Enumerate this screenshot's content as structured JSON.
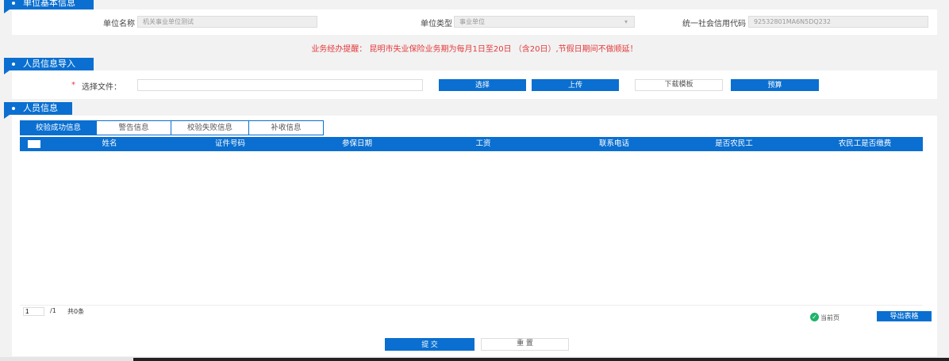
{
  "section1": {
    "title": "单位基本信息",
    "unit_name_label": "单位名称",
    "unit_name_value": "机关事业单位测试",
    "unit_type_label": "单位类型",
    "unit_type_value": "事业单位",
    "credit_code_label": "统一社会信用代码",
    "credit_code_value": "92532801MA6N5DQ232"
  },
  "notice": "业务经办提醒： 昆明市失业保险业务期为每月1日至20日 （含20日）,节假日期间不做顺延！",
  "section2": {
    "title": "人员信息导入",
    "required_mark": "*",
    "file_label": "选择文件：",
    "file_value": "",
    "select_btn": "选择",
    "upload_btn": "上传",
    "download_btn": "下载模板",
    "precalc_btn": "预算"
  },
  "section3": {
    "title": "人员信息",
    "tabs": [
      "校验成功信息",
      "警告信息",
      "校验失败信息",
      "补收信息"
    ],
    "columns": [
      "姓名",
      "证件号码",
      "参保日期",
      "工资",
      "联系电话",
      "是否农民工",
      "农民工是否缴费"
    ]
  },
  "pagination": {
    "page": "1",
    "total_pages": "/1",
    "total": "共0条",
    "current_page_label": "当前页",
    "export_btn": "导出表格"
  },
  "footer": {
    "submit": "提 交",
    "reset": "重 置"
  },
  "colors": {
    "primary": "#0a6fd0",
    "notice": "#e4393c"
  }
}
